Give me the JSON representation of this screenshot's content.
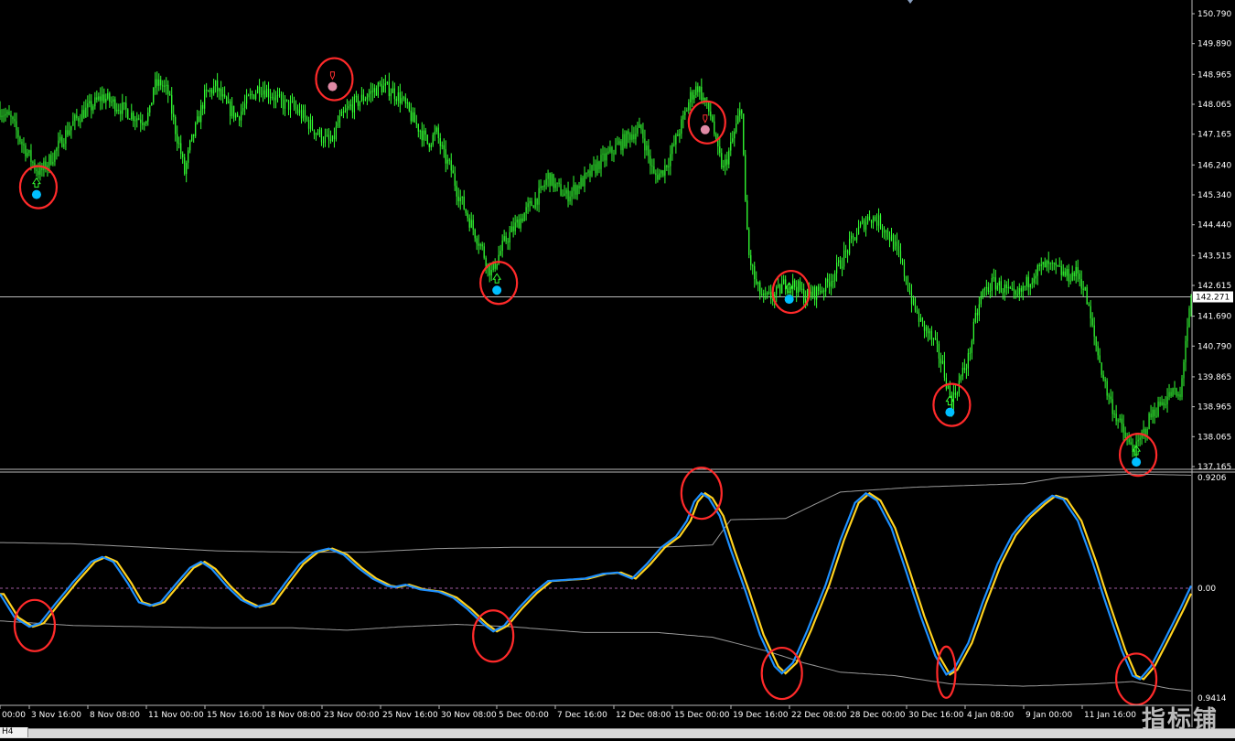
{
  "colors": {
    "background": "#000000",
    "candles": "#33ff33",
    "grid_line": "#b9b9b9",
    "axis_text": "#ffffff",
    "signal_buy": "#00bfff",
    "signal_sell": "#e08aa6",
    "circle": "#ff2a2a",
    "osc_fast": "#1e90ff",
    "osc_slow": "#ffd21f",
    "band": "#9a9a9a",
    "zero_line": "#a05aa0"
  },
  "timeframe_tab": "H4",
  "watermark": "指标铺",
  "chart_data": [
    {
      "type": "candlestick",
      "price_ticks": [
        "150.790",
        "149.890",
        "148.965",
        "148.065",
        "147.165",
        "146.240",
        "145.340",
        "144.440",
        "143.515",
        "142.615",
        "141.690",
        "140.790",
        "139.865",
        "138.965",
        "138.065",
        "137.165"
      ],
      "ylim": [
        137.165,
        150.79
      ],
      "current_price": "142.271",
      "time_labels": [
        "00:00",
        "3 Nov 16:00",
        "8 Nov 08:00",
        "11 Nov 00:00",
        "15 Nov 16:00",
        "18 Nov 08:00",
        "23 Nov 00:00",
        "25 Nov 16:00",
        "30 Nov 08:00",
        "5 Dec 00:00",
        "7 Dec 16:00",
        "12 Dec 08:00",
        "15 Dec 00:00",
        "19 Dec 16:00",
        "22 Dec 08:00",
        "28 Dec 00:00",
        "30 Dec 16:00",
        "4 Jan 08:00",
        "9 Jan 00:00",
        "11 Jan 16:00"
      ],
      "close_path": [
        [
          0,
          147.9
        ],
        [
          6,
          147.6
        ],
        [
          12,
          146.9
        ],
        [
          16,
          146.5
        ],
        [
          19,
          146.2
        ],
        [
          22,
          146.0
        ],
        [
          26,
          146.3
        ],
        [
          30,
          146.6
        ],
        [
          35,
          147.1
        ],
        [
          40,
          147.5
        ],
        [
          45,
          147.8
        ],
        [
          50,
          148.0
        ],
        [
          56,
          148.3
        ],
        [
          62,
          148.1
        ],
        [
          68,
          147.9
        ],
        [
          74,
          147.7
        ],
        [
          78,
          147.6
        ],
        [
          82,
          147.8
        ],
        [
          84,
          148.6
        ],
        [
          88,
          148.7
        ],
        [
          92,
          148.4
        ],
        [
          96,
          147.3
        ],
        [
          99,
          146.6
        ],
        [
          101,
          146.0
        ],
        [
          104,
          146.8
        ],
        [
          108,
          147.5
        ],
        [
          112,
          148.3
        ],
        [
          118,
          148.6
        ],
        [
          124,
          148.0
        ],
        [
          130,
          147.7
        ],
        [
          136,
          148.2
        ],
        [
          142,
          148.6
        ],
        [
          148,
          148.4
        ],
        [
          154,
          148.1
        ],
        [
          160,
          148.0
        ],
        [
          166,
          147.7
        ],
        [
          172,
          147.3
        ],
        [
          178,
          147.0
        ],
        [
          182,
          146.9
        ],
        [
          185,
          147.5
        ],
        [
          192,
          148.0
        ],
        [
          200,
          148.3
        ],
        [
          208,
          148.6
        ],
        [
          214,
          148.5
        ],
        [
          220,
          148.2
        ],
        [
          226,
          147.6
        ],
        [
          230,
          147.3
        ],
        [
          234,
          146.9
        ],
        [
          239,
          147.2
        ],
        [
          243,
          146.5
        ],
        [
          247,
          146.1
        ],
        [
          250,
          145.5
        ],
        [
          253,
          145.1
        ],
        [
          256,
          144.7
        ],
        [
          260,
          144.2
        ],
        [
          264,
          143.7
        ],
        [
          267,
          143.2
        ],
        [
          269,
          143.0
        ],
        [
          272,
          143.4
        ],
        [
          276,
          143.9
        ],
        [
          282,
          144.4
        ],
        [
          290,
          145.0
        ],
        [
          296,
          145.4
        ],
        [
          300,
          145.9
        ],
        [
          304,
          145.6
        ],
        [
          310,
          145.3
        ],
        [
          316,
          145.6
        ],
        [
          322,
          145.9
        ],
        [
          328,
          146.3
        ],
        [
          334,
          146.6
        ],
        [
          340,
          146.9
        ],
        [
          346,
          147.2
        ],
        [
          351,
          147.3
        ],
        [
          354,
          146.7
        ],
        [
          358,
          145.9
        ],
        [
          362,
          146.0
        ],
        [
          366,
          146.4
        ],
        [
          370,
          147.0
        ],
        [
          374,
          147.6
        ],
        [
          378,
          148.3
        ],
        [
          382,
          148.6
        ],
        [
          386,
          148.1
        ],
        [
          390,
          147.6
        ],
        [
          392,
          146.8
        ],
        [
          396,
          146.1
        ],
        [
          400,
          146.8
        ],
        [
          404,
          147.6
        ],
        [
          406,
          148.0
        ],
        [
          408,
          145.0
        ],
        [
          410,
          143.5
        ],
        [
          414,
          142.6
        ],
        [
          418,
          142.2
        ],
        [
          424,
          142.3
        ],
        [
          430,
          142.7
        ],
        [
          436,
          142.6
        ],
        [
          440,
          142.3
        ],
        [
          446,
          142.4
        ],
        [
          452,
          142.6
        ],
        [
          458,
          143.1
        ],
        [
          464,
          143.7
        ],
        [
          470,
          144.3
        ],
        [
          476,
          144.7
        ],
        [
          482,
          144.5
        ],
        [
          488,
          144.0
        ],
        [
          492,
          143.5
        ],
        [
          496,
          142.8
        ],
        [
          500,
          142.0
        ],
        [
          504,
          141.5
        ],
        [
          508,
          141.2
        ],
        [
          512,
          140.8
        ],
        [
          516,
          140.2
        ],
        [
          519,
          139.5
        ],
        [
          521,
          139.1
        ],
        [
          525,
          139.7
        ],
        [
          530,
          140.4
        ],
        [
          534,
          141.6
        ],
        [
          538,
          142.4
        ],
        [
          544,
          142.7
        ],
        [
          550,
          142.5
        ],
        [
          556,
          142.2
        ],
        [
          560,
          142.5
        ],
        [
          566,
          143.0
        ],
        [
          572,
          143.2
        ],
        [
          578,
          143.1
        ],
        [
          584,
          142.9
        ],
        [
          590,
          143.0
        ],
        [
          594,
          142.4
        ],
        [
          598,
          141.3
        ],
        [
          602,
          140.3
        ],
        [
          606,
          139.4
        ],
        [
          610,
          138.8
        ],
        [
          614,
          138.3
        ],
        [
          618,
          137.8
        ],
        [
          622,
          137.7
        ],
        [
          626,
          138.2
        ],
        [
          630,
          138.7
        ],
        [
          636,
          139.1
        ],
        [
          642,
          139.4
        ],
        [
          646,
          139.2
        ],
        [
          649,
          141.0
        ],
        [
          652,
          142.1
        ]
      ],
      "signals": [
        {
          "t": 20,
          "price": 145.35,
          "kind": "buy"
        },
        {
          "t": 272,
          "price": 142.47,
          "kind": "buy"
        },
        {
          "t": 182,
          "price": 148.6,
          "kind": "sell"
        },
        {
          "t": 386,
          "price": 147.3,
          "kind": "sell"
        },
        {
          "t": 432,
          "price": 142.2,
          "kind": "buy"
        },
        {
          "t": 520,
          "price": 138.8,
          "kind": "buy"
        },
        {
          "t": 622,
          "price": 137.3,
          "kind": "buy"
        }
      ]
    },
    {
      "type": "line",
      "oscillator_labels": {
        "top": "0.9206",
        "zero": "0.00",
        "bottom": "0.9414"
      },
      "ylim": [
        -0.9414,
        0.9206
      ],
      "fast_line": [
        [
          0,
          -0.05
        ],
        [
          8,
          -0.25
        ],
        [
          16,
          -0.33
        ],
        [
          22,
          -0.3
        ],
        [
          30,
          -0.14
        ],
        [
          40,
          0.05
        ],
        [
          50,
          0.22
        ],
        [
          56,
          0.26
        ],
        [
          62,
          0.22
        ],
        [
          70,
          0.04
        ],
        [
          76,
          -0.12
        ],
        [
          82,
          -0.15
        ],
        [
          88,
          -0.12
        ],
        [
          96,
          0.03
        ],
        [
          104,
          0.17
        ],
        [
          110,
          0.22
        ],
        [
          116,
          0.16
        ],
        [
          124,
          0.02
        ],
        [
          132,
          -0.1
        ],
        [
          140,
          -0.16
        ],
        [
          148,
          -0.13
        ],
        [
          156,
          0.04
        ],
        [
          164,
          0.2
        ],
        [
          172,
          0.3
        ],
        [
          180,
          0.33
        ],
        [
          188,
          0.28
        ],
        [
          196,
          0.17
        ],
        [
          204,
          0.08
        ],
        [
          212,
          0.02
        ],
        [
          216,
          0.01
        ],
        [
          222,
          0.03
        ],
        [
          230,
          -0.01
        ],
        [
          240,
          -0.03
        ],
        [
          248,
          -0.08
        ],
        [
          256,
          -0.18
        ],
        [
          264,
          -0.3
        ],
        [
          270,
          -0.37
        ],
        [
          276,
          -0.32
        ],
        [
          284,
          -0.17
        ],
        [
          292,
          -0.04
        ],
        [
          300,
          0.06
        ],
        [
          310,
          0.07
        ],
        [
          320,
          0.08
        ],
        [
          330,
          0.12
        ],
        [
          338,
          0.13
        ],
        [
          346,
          0.08
        ],
        [
          354,
          0.2
        ],
        [
          362,
          0.34
        ],
        [
          370,
          0.43
        ],
        [
          376,
          0.56
        ],
        [
          380,
          0.72
        ],
        [
          384,
          0.79
        ],
        [
          388,
          0.75
        ],
        [
          394,
          0.6
        ],
        [
          400,
          0.32
        ],
        [
          408,
          -0.02
        ],
        [
          416,
          -0.4
        ],
        [
          424,
          -0.67
        ],
        [
          428,
          -0.73
        ],
        [
          434,
          -0.64
        ],
        [
          442,
          -0.36
        ],
        [
          452,
          0.03
        ],
        [
          460,
          0.4
        ],
        [
          468,
          0.71
        ],
        [
          474,
          0.79
        ],
        [
          480,
          0.73
        ],
        [
          488,
          0.5
        ],
        [
          496,
          0.14
        ],
        [
          504,
          -0.24
        ],
        [
          512,
          -0.58
        ],
        [
          518,
          -0.74
        ],
        [
          522,
          -0.7
        ],
        [
          530,
          -0.47
        ],
        [
          538,
          -0.12
        ],
        [
          546,
          0.2
        ],
        [
          554,
          0.44
        ],
        [
          562,
          0.59
        ],
        [
          570,
          0.7
        ],
        [
          576,
          0.77
        ],
        [
          582,
          0.74
        ],
        [
          590,
          0.56
        ],
        [
          598,
          0.22
        ],
        [
          606,
          -0.16
        ],
        [
          614,
          -0.53
        ],
        [
          620,
          -0.75
        ],
        [
          624,
          -0.78
        ],
        [
          630,
          -0.67
        ],
        [
          638,
          -0.43
        ],
        [
          646,
          -0.18
        ],
        [
          652,
          0.02
        ]
      ],
      "slow_line_offset": 2,
      "upper_band": [
        [
          0,
          0.38
        ],
        [
          40,
          0.37
        ],
        [
          80,
          0.34
        ],
        [
          120,
          0.31
        ],
        [
          160,
          0.3
        ],
        [
          200,
          0.3
        ],
        [
          240,
          0.33
        ],
        [
          280,
          0.34
        ],
        [
          320,
          0.34
        ],
        [
          360,
          0.34
        ],
        [
          390,
          0.36
        ],
        [
          400,
          0.57
        ],
        [
          430,
          0.58
        ],
        [
          460,
          0.8
        ],
        [
          500,
          0.84
        ],
        [
          540,
          0.86
        ],
        [
          560,
          0.87
        ],
        [
          580,
          0.92
        ],
        [
          620,
          0.95
        ],
        [
          652,
          0.94
        ]
      ],
      "lower_band": [
        [
          0,
          -0.28
        ],
        [
          40,
          -0.32
        ],
        [
          80,
          -0.33
        ],
        [
          120,
          -0.34
        ],
        [
          160,
          -0.34
        ],
        [
          190,
          -0.36
        ],
        [
          220,
          -0.33
        ],
        [
          250,
          -0.31
        ],
        [
          280,
          -0.33
        ],
        [
          320,
          -0.38
        ],
        [
          360,
          -0.38
        ],
        [
          390,
          -0.42
        ],
        [
          420,
          -0.54
        ],
        [
          440,
          -0.64
        ],
        [
          460,
          -0.72
        ],
        [
          490,
          -0.75
        ],
        [
          520,
          -0.82
        ],
        [
          560,
          -0.84
        ],
        [
          600,
          -0.82
        ],
        [
          620,
          -0.8
        ],
        [
          640,
          -0.86
        ],
        [
          652,
          -0.88
        ]
      ],
      "circled_points": [
        {
          "t": 19,
          "v": -0.32
        },
        {
          "t": 270,
          "v": -0.41
        },
        {
          "t": 384,
          "v": 0.79
        },
        {
          "t": 428,
          "v": -0.73
        },
        {
          "t": 518,
          "v": -0.72
        },
        {
          "t": 622,
          "v": -0.78
        }
      ]
    }
  ]
}
